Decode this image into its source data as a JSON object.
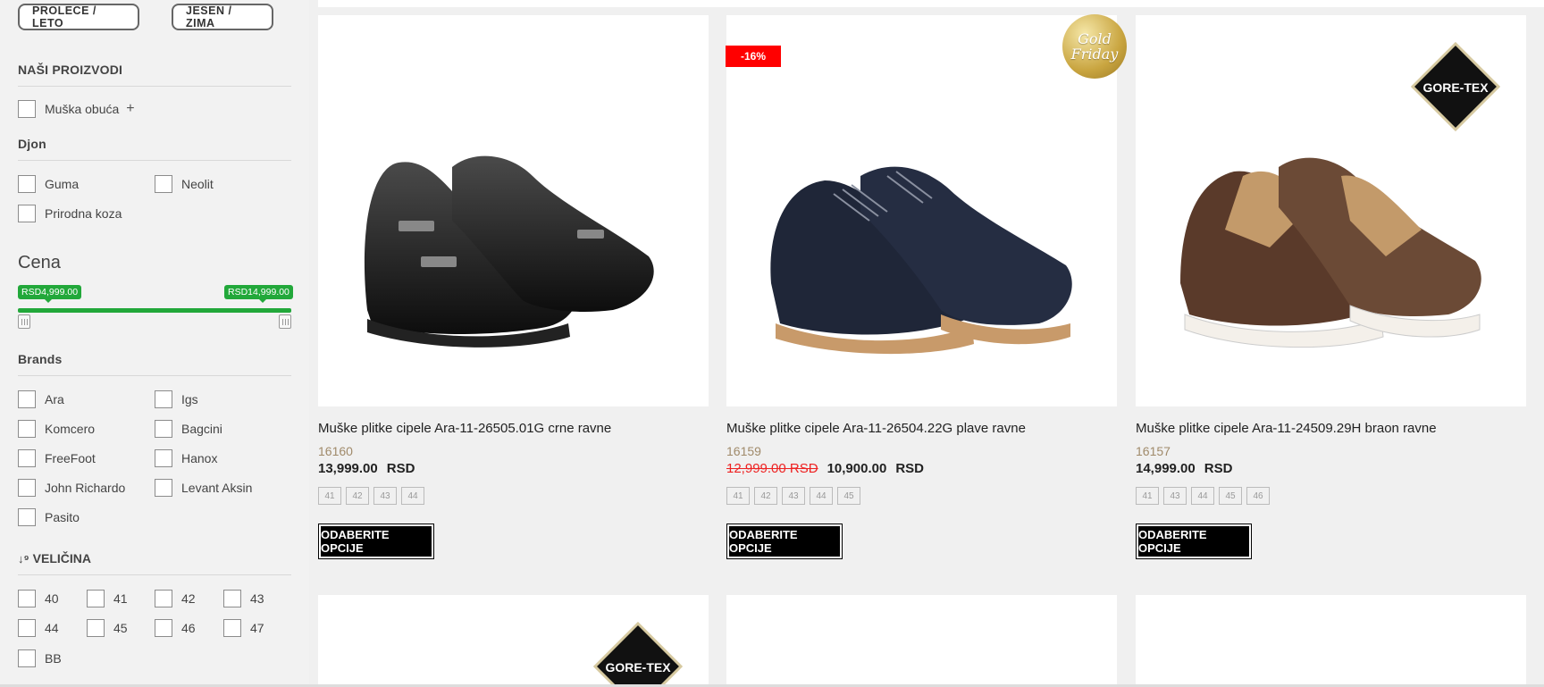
{
  "season": {
    "spring_summer": "PROLECE / LETO",
    "autumn_winter": "JESEN / ZIMA"
  },
  "filters": {
    "products_title": "NAŠI PROIZVODI",
    "products_item": "Muška obuća",
    "sole_title": "Djon",
    "sole_items": [
      "Guma",
      "Neolit",
      "Prirodna koza"
    ],
    "price_title": "Cena",
    "price_min": "RSD4,999.00",
    "price_max": "RSD14,999.00",
    "brands_title": "Brands",
    "brands": [
      "Ara",
      "Igs",
      "Komcero",
      "Bagcini",
      "FreeFoot",
      "Hanox",
      "John Richardo",
      "Levant Aksin",
      "Pasito"
    ],
    "size_title": "VELIČINA",
    "sizes": [
      "40",
      "41",
      "42",
      "43",
      "44",
      "45",
      "46",
      "47",
      "BB"
    ]
  },
  "products": [
    {
      "title": "Muške plitke cipele Ara-11-26505.01G crne ravne",
      "code": "16160",
      "old_price": "",
      "price": "13,999.00",
      "currency": "RSD",
      "sizes": [
        "41",
        "42",
        "43",
        "44"
      ],
      "button": "ODABERITE OPCIJE"
    },
    {
      "title": "Muške plitke cipele Ara-11-26504.22G plave ravne",
      "code": "16159",
      "old_price": "12,999.00 RSD",
      "price": "10,900.00",
      "currency": "RSD",
      "sizes": [
        "41",
        "42",
        "43",
        "44",
        "45"
      ],
      "button": "ODABERITE OPCIJE",
      "discount": "-16%",
      "gold_badge": [
        "Gold",
        "Friday"
      ]
    },
    {
      "title": "Muške plitke cipele Ara-11-24509.29H braon ravne",
      "code": "16157",
      "old_price": "",
      "price": "14,999.00",
      "currency": "RSD",
      "sizes": [
        "41",
        "43",
        "44",
        "45",
        "46"
      ],
      "button": "ODABERITE OPCIJE",
      "gore_tex": "GORE-TEX"
    }
  ],
  "gore_tex_label": "GORE-TEX",
  "colors": {
    "accent_green": "#22a83a",
    "discount_red": "#ff0000",
    "button_black": "#000000"
  }
}
